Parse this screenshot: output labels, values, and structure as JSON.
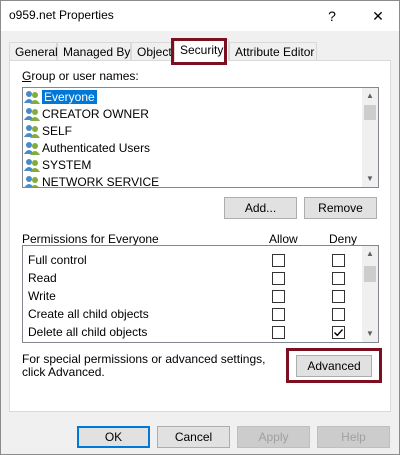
{
  "window": {
    "title": "o959.net Properties",
    "help_glyph": "?",
    "close_glyph": "✕"
  },
  "tabs": [
    {
      "label": "General"
    },
    {
      "label": "Managed By"
    },
    {
      "label": "Object"
    },
    {
      "label": "Security",
      "active": true
    },
    {
      "label": "Attribute Editor"
    }
  ],
  "groups": {
    "label": "Group or user names:",
    "items": [
      {
        "name": "Everyone",
        "selected": true,
        "icon": "users-icon"
      },
      {
        "name": "CREATOR OWNER",
        "icon": "users-icon"
      },
      {
        "name": "SELF",
        "icon": "users-icon"
      },
      {
        "name": "Authenticated Users",
        "icon": "users-icon"
      },
      {
        "name": "SYSTEM",
        "icon": "users-icon"
      },
      {
        "name": "NETWORK SERVICE",
        "icon": "users-icon"
      }
    ],
    "add_label": "Add...",
    "remove_label": "Remove"
  },
  "permissions": {
    "label": "Permissions for Everyone",
    "allow_header": "Allow",
    "deny_header": "Deny",
    "rows": [
      {
        "name": "Full control",
        "allow": false,
        "deny": false
      },
      {
        "name": "Read",
        "allow": false,
        "deny": false
      },
      {
        "name": "Write",
        "allow": false,
        "deny": false
      },
      {
        "name": "Create all child objects",
        "allow": false,
        "deny": false
      },
      {
        "name": "Delete all child objects",
        "allow": false,
        "deny": true
      }
    ]
  },
  "advanced": {
    "text": "For special permissions or advanced settings, click Advanced.",
    "button_label": "Advanced"
  },
  "footer": {
    "ok": "OK",
    "cancel": "Cancel",
    "apply": "Apply",
    "help": "Help"
  },
  "colors": {
    "highlight_border": "#7b1020",
    "selection": "#0078d7"
  }
}
